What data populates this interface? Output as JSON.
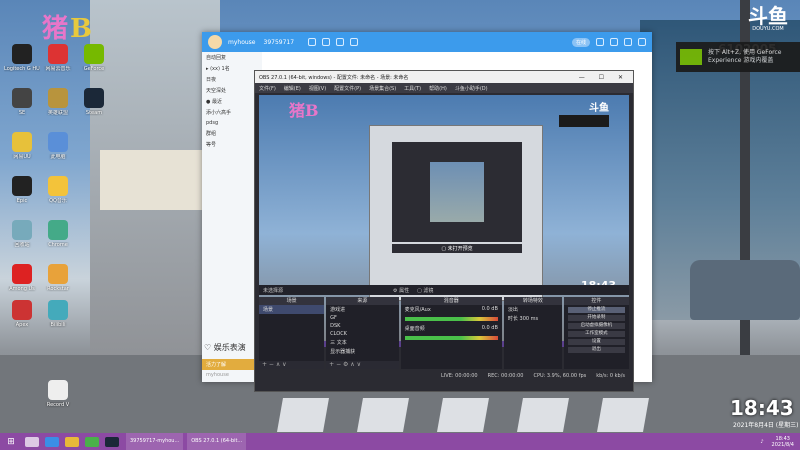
{
  "watermark": {
    "logo_main": "猪",
    "logo_b": "B",
    "brand_cn": "斗鱼",
    "brand_en": "DOUYU.COM",
    "room_number": "6102005"
  },
  "toast": {
    "line1": "按下 Alt+Z, 使用 GeForce",
    "line2": "Experience 游戏内覆盖"
  },
  "desktop_icons": [
    {
      "label": "Logitech G HUB",
      "color": "#222"
    },
    {
      "label": "网易云音乐",
      "color": "#d33"
    },
    {
      "label": "SE",
      "color": "#444"
    },
    {
      "label": "英雄联盟",
      "color": "#b8943d"
    },
    {
      "label": "GeForce",
      "color": "#76b900"
    },
    {
      "label": "Steam",
      "color": "#1b2838"
    },
    {
      "label": "网易UU",
      "color": "#e7c13a"
    },
    {
      "label": "此电脑",
      "color": "#5a8fd8"
    },
    {
      "label": "Epic",
      "color": "#222"
    },
    {
      "label": "QQ音乐",
      "color": "#f3c33a"
    },
    {
      "label": "回收站",
      "color": "#7ab"
    },
    {
      "label": "Chrome",
      "color": "#4a8"
    },
    {
      "label": "Among Us",
      "color": "#d22"
    },
    {
      "label": "Rockstar",
      "color": "#e8a23a"
    },
    {
      "label": "Apex",
      "color": "#c33"
    },
    {
      "label": "Bilibili",
      "color": "#4ab"
    },
    {
      "label": "Record V",
      "color": "#eee"
    }
  ],
  "chat": {
    "contact_name": "myhouse",
    "contact_id": "39759717",
    "badge": "在线",
    "sidebar": [
      "自动回复",
      "▸ (xx) 1名",
      "日夜",
      "天空深处",
      "● 最近",
      "添小六高手",
      "pdsg",
      "群组",
      "等号"
    ],
    "emoji_label": "娱乐表演",
    "bar_label": "活力了解",
    "username": "myhouse"
  },
  "obs": {
    "title": "OBS 27.0.1 (64-bit, windows) - 配置文件: 未命名 - 场景: 未命名",
    "window_controls": "— ☐ ✕",
    "menu": [
      "文件(F)",
      "编辑(E)",
      "视图(V)",
      "配置文件(P)",
      "场景集合(S)",
      "工具(T)",
      "帮助(H)",
      "斗鱼小助手(D)"
    ],
    "preview": {
      "logo": "猪B",
      "brand": "斗鱼",
      "nested_label": "▢ 未打开预览",
      "clock": "18:43"
    },
    "scene_bar_left": "未选择源",
    "scene_bar_props": "⚙ 属性",
    "scene_bar_filters": "▢ 滤镜",
    "docks": {
      "scenes": {
        "header": "场景",
        "items": [
          "场景"
        ],
        "footer": "+ − ∧ ∨"
      },
      "sources": {
        "header": "来源",
        "items": [
          "游戏进",
          "GF",
          "DSK",
          "CLOCK",
          "三 文本",
          "显示器捕获"
        ],
        "footer": "+ − ⚙ ∧ ∨"
      },
      "mixer": {
        "header": "混音器",
        "tracks": [
          {
            "name": "麦克风/Aux",
            "level": "0.0 dB"
          },
          {
            "name": "桌面音频",
            "level": "0.0 dB"
          }
        ]
      },
      "transitions": {
        "header": "转场特效",
        "type_label": "淡出",
        "duration_label": "时长",
        "duration_value": "300 ms"
      },
      "controls": {
        "header": "控件",
        "buttons": [
          "停止推流",
          "开始录制",
          "启动虚拟摄像机",
          "工作室模式",
          "设置",
          "退出"
        ]
      }
    },
    "status": {
      "live": "LIVE: 00:00:00",
      "rec": "REC: 00:00:00",
      "cpu": "CPU: 3.9%, 60.00 fps",
      "kbs": "kb/s: 0 kb/s"
    }
  },
  "clock": {
    "time": "18:43",
    "date": "2021年8月4日 (星期三)"
  },
  "taskbar": {
    "start": "⊞",
    "apps": [
      "39759717-myhou...",
      "OBS 27.0.1 (64-bit..."
    ],
    "tray_time": "18:43",
    "tray_date": "2021/8/4"
  }
}
